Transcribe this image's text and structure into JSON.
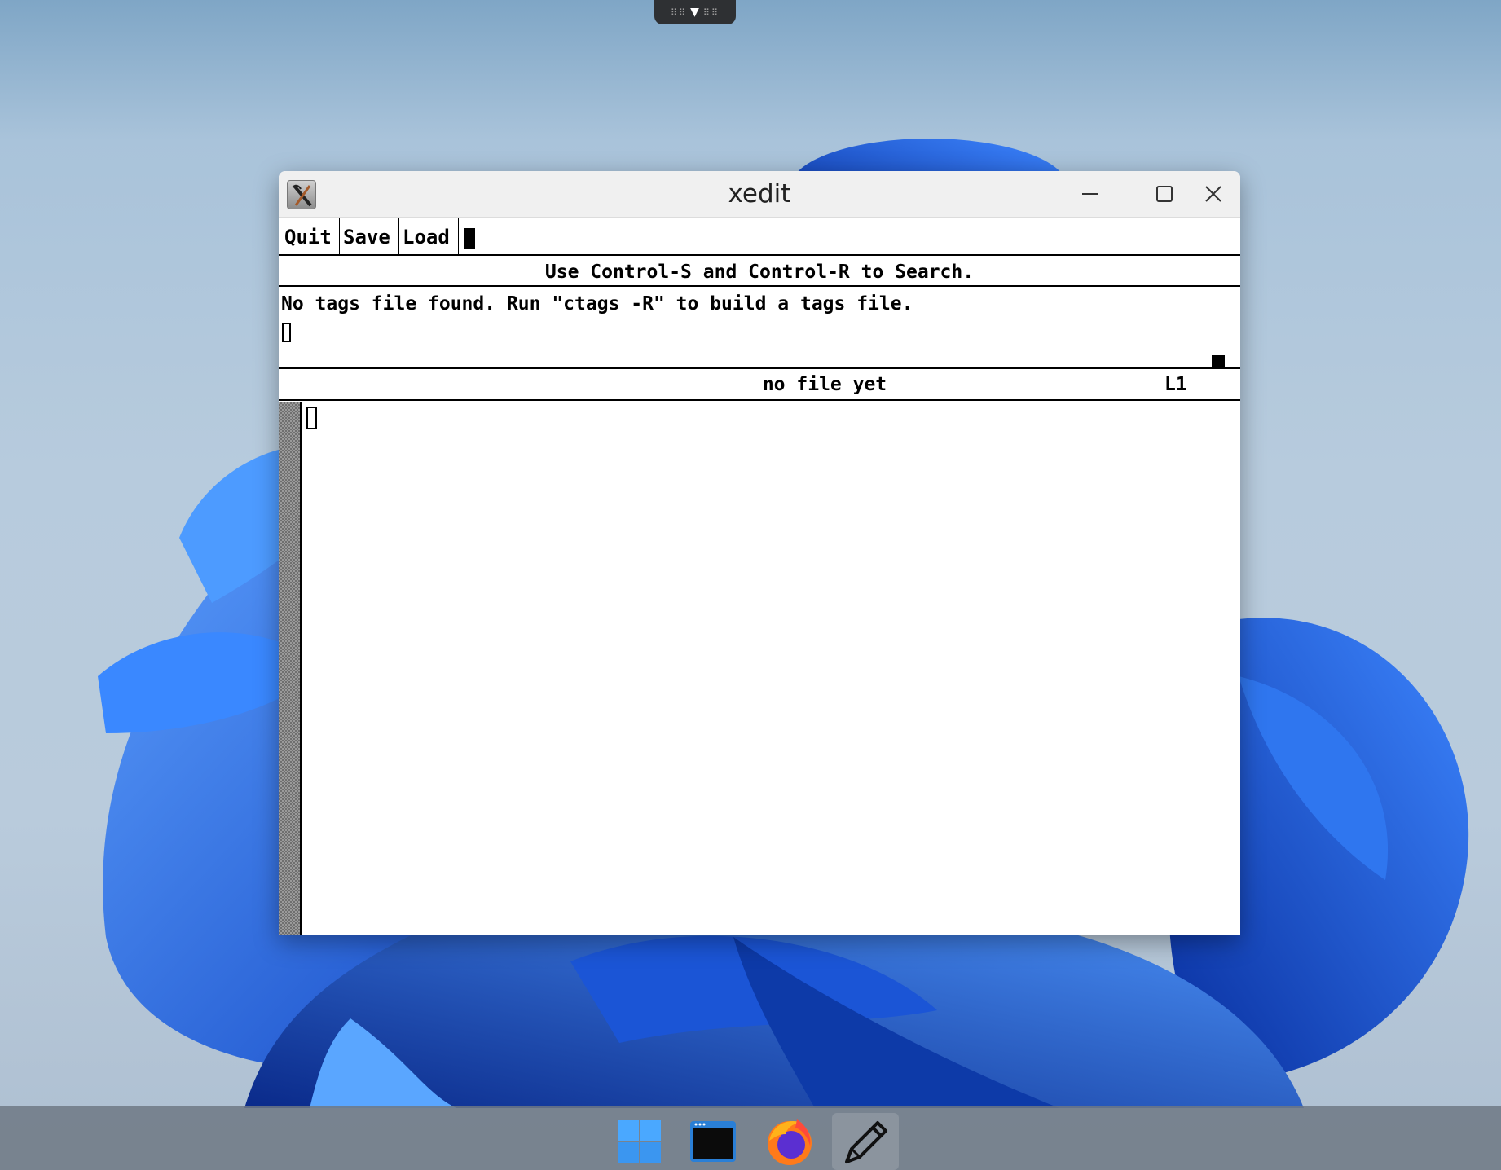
{
  "window": {
    "title": "xedit"
  },
  "toolbar": {
    "quit_label": "Quit",
    "save_label": "Save",
    "load_label": "Load",
    "filename_value": ""
  },
  "hint": {
    "text": "Use Control-S and Control-R to Search."
  },
  "messages": {
    "text": "No tags file found. Run \"ctags -R\" to build a tags file."
  },
  "status": {
    "filename": "no file yet",
    "line": "L1"
  },
  "editor": {
    "content": ""
  },
  "taskbar": {
    "items": [
      {
        "name": "start",
        "icon": "windows-logo-icon"
      },
      {
        "name": "terminal",
        "icon": "terminal-icon"
      },
      {
        "name": "firefox",
        "icon": "firefox-icon"
      },
      {
        "name": "xedit",
        "icon": "pencil-icon",
        "active": true
      }
    ]
  },
  "colors": {
    "wallpaper_bg": "#b7cbdd",
    "wallpaper_accent": "#1f5fe0",
    "titlebar": "#f0f0f0",
    "taskbar": "#6e7884"
  }
}
